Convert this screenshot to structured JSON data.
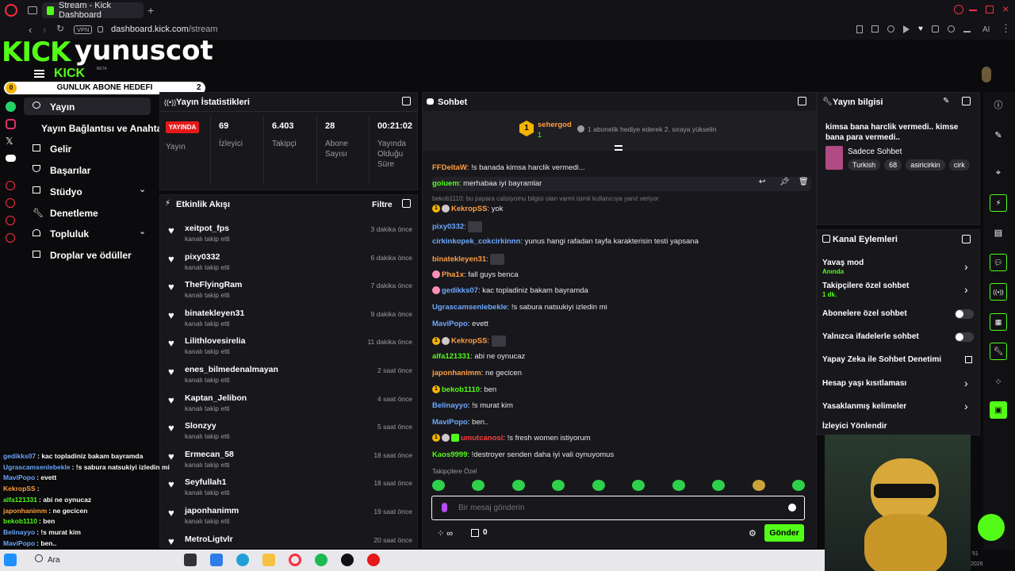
{
  "browser": {
    "tab_title": "Stream - Kick Dashboard",
    "url_domain": "dashboard.kick.com",
    "url_path": "/stream",
    "vpn": "VPN",
    "ai_label": "AI"
  },
  "overlay": {
    "brand": "KICK",
    "username": "yunuscot",
    "sub_goal_label": "GUNLUK ABONE HEDEFI",
    "sub_goal_start": "0",
    "sub_goal_end": "2",
    "sub_goal_progress": 0
  },
  "header": {
    "logo": "KICK",
    "beta": "BETA"
  },
  "nav": {
    "items": [
      {
        "label": "Yayın"
      },
      {
        "label": "Yayın Bağlantısı ve Anahtarı"
      },
      {
        "label": "Gelir"
      },
      {
        "label": "Başarılar"
      },
      {
        "label": "Stüdyo"
      },
      {
        "label": "Denetleme"
      },
      {
        "label": "Topluluk"
      },
      {
        "label": "Droplar ve ödüller"
      }
    ]
  },
  "stats": {
    "title": "Yayın İstatistikleri",
    "live_badge": "YAYINDA",
    "status_label": "Yayın",
    "viewers": "69",
    "viewers_label": "İzleyici",
    "followers": "6.403",
    "followers_label": "Takipçi",
    "subs": "28",
    "subs_label": "Abone Sayısı",
    "uptime": "00:21:02",
    "uptime_label": "Yayında Olduğu Süre"
  },
  "activity": {
    "title": "Etkinlik Akışı",
    "filter_label": "Filtre",
    "items": [
      {
        "name": "xeitpot_fps",
        "desc": "kanalı takip etti",
        "time": "3 dakika önce"
      },
      {
        "name": "pixy0332",
        "desc": "kanalı takip etti",
        "time": "6 dakika önce"
      },
      {
        "name": "TheFlyingRam",
        "desc": "kanalı takip etti",
        "time": "7 dakika önce"
      },
      {
        "name": "binatekleyen31",
        "desc": "kanalı takip etti",
        "time": "9 dakika önce"
      },
      {
        "name": "Lilithlovesirelia",
        "desc": "kanalı takip etti",
        "time": "11 dakika önce"
      },
      {
        "name": "enes_bilmedenalmayan",
        "desc": "kanalı takip etti",
        "time": "2 saat önce"
      },
      {
        "name": "Kaptan_Jelibon",
        "desc": "kanalı takip etti",
        "time": "4 saat önce"
      },
      {
        "name": "Slonzyy",
        "desc": "kanalı takip etti",
        "time": "5 saat önce"
      },
      {
        "name": "Ermecan_58",
        "desc": "kanalı takip etti",
        "time": "18 saat önce"
      },
      {
        "name": "Seyfullah1",
        "desc": "kanalı takip etti",
        "time": "18 saat önce"
      },
      {
        "name": "japonhanimm",
        "desc": "kanalı takip etti",
        "time": "19 saat önce"
      },
      {
        "name": "MetroLigtvlr",
        "desc": "",
        "time": "20 saat önce"
      }
    ]
  },
  "chat": {
    "title": "Sohbet",
    "pinned_user": "sehergod",
    "pinned_count": "1",
    "pinned_text": "1 abonelik hediye ederek 2. sıraya yükselin",
    "reply_note": "bekob1110: bu papara calisiyomu bilgisi olan varmi isimli kullanıcıya yanıt veriyor",
    "followers_only_label": "Takipçilere Özel",
    "input_placeholder": "Bir mesaj gönderin",
    "points": "0",
    "send_label": "Gönder",
    "colors": {
      "green": "#53fc18",
      "blue": "#6ea8fe",
      "orange": "#ff9f43",
      "pink": "#ff7ab8",
      "red": "#ff3b3b",
      "yellow": "#f5b400"
    },
    "messages": [
      {
        "user": "FFDeltaW",
        "text": "!s banada kimsa harclik vermedi...",
        "color": "#ff9f43",
        "badges": []
      },
      {
        "user": "goluem",
        "text": "merhabaa iyi bayramlar",
        "color": "#53fc18",
        "badges": []
      },
      {
        "user": "KekropSS",
        "text": "yok",
        "color": "#ff9f43",
        "badges": [
          "1",
          "b"
        ]
      },
      {
        "user": "pixy0332",
        "text": "",
        "color": "#6ea8fe",
        "badges": [],
        "emote": true
      },
      {
        "user": "cirkinkopek_cokcirkinnn",
        "text": "yunus hangi rafadan tayfa karakterisin testi yapsana",
        "color": "#6ea8fe",
        "badges": []
      },
      {
        "user": "binatekleyen31",
        "text": "",
        "color": "#ff9f43",
        "badges": [],
        "emote": true
      },
      {
        "user": "Pha1x",
        "text": "fall guys benca",
        "color": "#ff9f43",
        "badges": [
          "p"
        ]
      },
      {
        "user": "gedikks07",
        "text": "kac topladiniz bakam bayramda",
        "color": "#6ea8fe",
        "badges": [
          "p"
        ]
      },
      {
        "user": "Ugrascamsenlebekle",
        "text": "!s sabura natsukiyi izledin mi",
        "color": "#6ea8fe",
        "badges": []
      },
      {
        "user": "MaviPopo",
        "text": "evett",
        "color": "#6ea8fe",
        "badges": []
      },
      {
        "user": "KekropSS",
        "text": "",
        "color": "#ff9f43",
        "badges": [
          "1",
          "b"
        ],
        "emote": true
      },
      {
        "user": "alfa121331",
        "text": "abi ne oynucaz",
        "color": "#53fc18",
        "badges": []
      },
      {
        "user": "japonhanimm",
        "text": "ne gecicen",
        "color": "#ff9f43",
        "badges": []
      },
      {
        "user": "bekob1110",
        "text": "ben",
        "color": "#53fc18",
        "badges": [
          "1"
        ]
      },
      {
        "user": "Belinayyo",
        "text": "!s murat kim",
        "color": "#6ea8fe",
        "badges": []
      },
      {
        "user": "MaviPopo",
        "text": "ben..",
        "color": "#6ea8fe",
        "badges": []
      },
      {
        "user": "umutcanosi",
        "text": "!s fresh women istiyorum",
        "color": "#ff3b3b",
        "badges": [
          "1",
          "b",
          "g"
        ]
      },
      {
        "user": "Kaos9999",
        "text": "!destroyer senden daha iyi vali oynuyomus",
        "color": "#53fc18",
        "badges": []
      }
    ]
  },
  "stream_info": {
    "title": "Yayın bilgisi",
    "stream_title": "kimsa bana harclik vermedi.. kimse bana para vermedi..",
    "category": "Sadece Sohbet",
    "tags": [
      "Turkish",
      "68",
      "asiricirkin",
      "cirk"
    ]
  },
  "channel_actions": {
    "title": "Kanal Eylemleri",
    "slow_mode": "Yavaş mod",
    "slow_mode_value": "Anında",
    "followers_chat": "Takipçilere özel sohbet",
    "followers_chat_value": "1 dk.",
    "subs_chat": "Abonelere özel sohbet",
    "emotes_chat": "Yalnızca ifadelerle sohbet",
    "ai_moderation": "Yapay Zeka ile Sohbet Denetimi",
    "account_age": "Hesap yaşı kısıtlaması",
    "banned_words": "Yasaklanmış kelimeler",
    "raid": "İzleyici Yönlendir"
  },
  "overlay_chat": [
    {
      "user": "gedikks07",
      "text": ": kac topladiniz bakam bayramda",
      "color": "#6ea8fe"
    },
    {
      "user": "Ugrascamsenlebekle",
      "text": ": !s sabura natsukiyi izledin mi",
      "color": "#6ea8fe"
    },
    {
      "user": "MaviPopo",
      "text": ": evett",
      "color": "#6ea8fe"
    },
    {
      "user": "KekropSS",
      "text": ":",
      "color": "#ff9f43"
    },
    {
      "user": "alfa121331",
      "text": ": abi ne oynucaz",
      "color": "#53fc18"
    },
    {
      "user": "japonhanimm",
      "text": ": ne gecicen",
      "color": "#ff9f43"
    },
    {
      "user": "bekob1110",
      "text": ": ben",
      "color": "#53fc18"
    },
    {
      "user": "Belinayyo",
      "text": ": !s murat kim",
      "color": "#6ea8fe"
    },
    {
      "user": "MaviPopo",
      "text": ": ben..",
      "color": "#6ea8fe"
    },
    {
      "user": "umutcanosi",
      "text": ": !s fresh women istiyorum",
      "color": "#ff3b3b"
    },
    {
      "user": "destroyer",
      "text": "senden daha iyi vali oynuyomus",
      "color": "#bbbbbb"
    }
  ],
  "taskbar": {
    "search_label": "Ara",
    "clock_time": "51",
    "clock_year": "2026"
  }
}
